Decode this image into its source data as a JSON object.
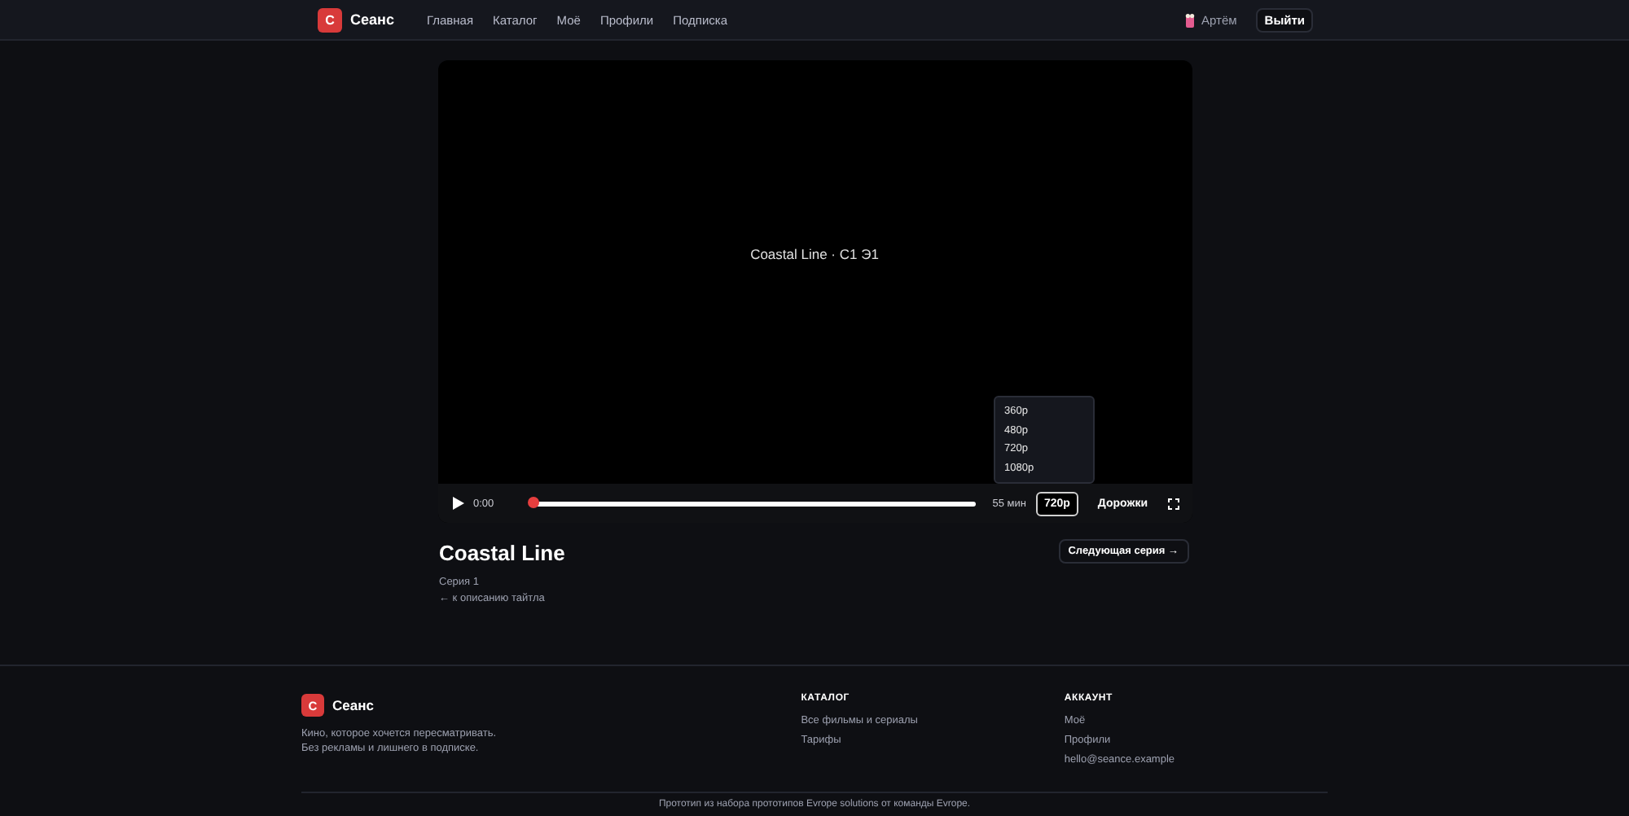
{
  "header": {
    "logo_letter": "С",
    "brand": "Сеанс",
    "nav": [
      {
        "label": "Главная",
        "selected": false
      },
      {
        "label": "Каталог",
        "selected": false
      },
      {
        "label": "Моё",
        "selected": false
      },
      {
        "label": "Профили",
        "selected": false
      },
      {
        "label": "Подписка",
        "selected": false
      }
    ],
    "user": "Артём",
    "logout": "Выйти"
  },
  "player": {
    "caption": "Coastal Line · С1 Э1",
    "time": "0:00",
    "level": 0,
    "duration": "55 мин",
    "quality": "720p",
    "tracks": "Дорожки",
    "quality_menu": {
      "expanded": true,
      "options": [
        "360p",
        "480p",
        "720p",
        "1080p"
      ]
    }
  },
  "episode": {
    "title": "Coastal Line",
    "subtitle": "Серия 1",
    "back_link": "← к описанию тайтла",
    "next_button": "Следующая серия →"
  },
  "footer": {
    "logo_letter": "С",
    "brand": "Сеанс",
    "tagline": [
      "Кино, которое хочется пересматривать.",
      "Без рекламы и лишнего в подписке."
    ],
    "columns": [
      {
        "heading": "КАТАЛОГ",
        "links": [
          "Все фильмы и сериалы",
          "Тарифы"
        ]
      },
      {
        "heading": "АККАУНТ",
        "links": [
          "Моё",
          "Профили",
          "hello@seance.example"
        ]
      }
    ],
    "copyright": "Прототип из набора прототипов Evrope solutions от команды Evrope."
  }
}
